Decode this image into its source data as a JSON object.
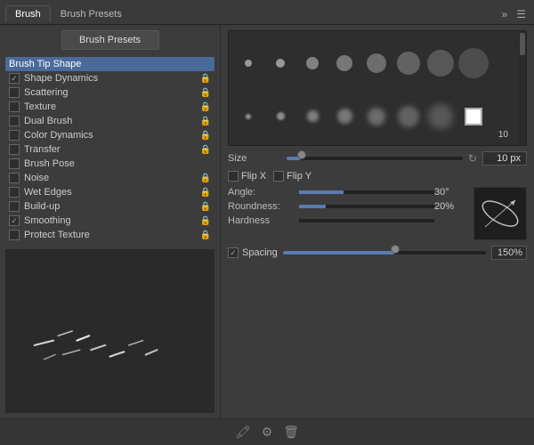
{
  "tabs": {
    "brush": "Brush",
    "brush_presets": "Brush Presets"
  },
  "buttons": {
    "brush_presets": "Brush Presets"
  },
  "list": {
    "brush_tip_shape": "Brush Tip Shape",
    "shape_dynamics": "Shape Dynamics",
    "scattering": "Scattering",
    "texture": "Texture",
    "dual_brush": "Dual Brush",
    "color_dynamics": "Color Dynamics",
    "transfer": "Transfer",
    "brush_pose": "Brush Pose",
    "noise": "Noise",
    "wet_edges": "Wet Edges",
    "build_up": "Build-up",
    "smoothing": "Smoothing",
    "protect_texture": "Protect Texture"
  },
  "brush": {
    "size_label": "10"
  },
  "props": {
    "size_label": "Size",
    "size_value": "10 px",
    "flip_x": "Flip X",
    "flip_y": "Flip Y",
    "angle_label": "Angle:",
    "angle_value": "30°",
    "roundness_label": "Roundness:",
    "roundness_value": "20%",
    "hardness_label": "Hardness",
    "spacing_label": "Spacing",
    "spacing_value": "150%"
  }
}
